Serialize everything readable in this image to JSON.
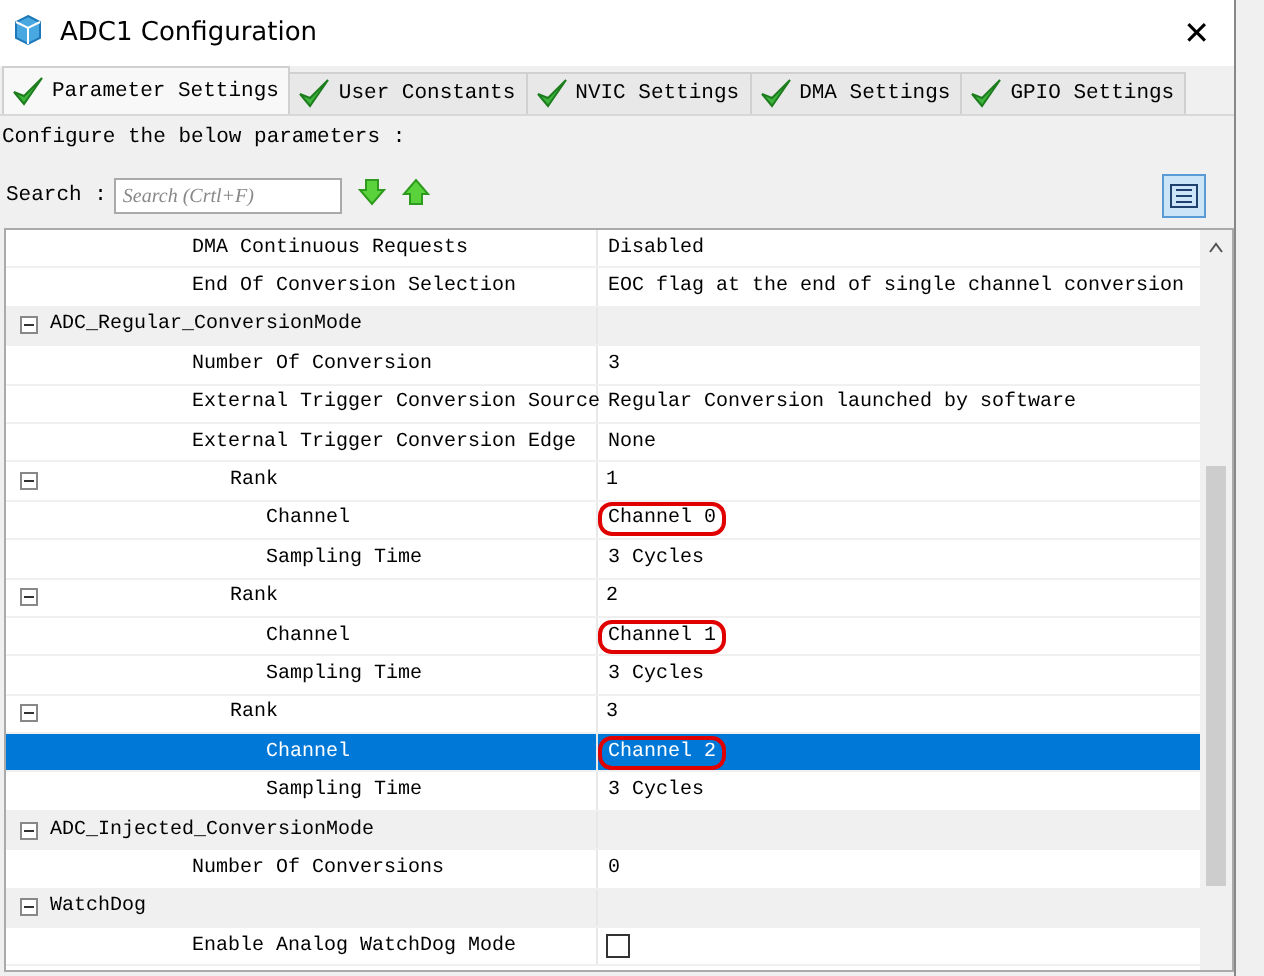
{
  "window": {
    "title": "ADC1 Configuration",
    "close": "✕"
  },
  "tabs": [
    {
      "label": "Parameter Settings",
      "selected": true
    },
    {
      "label": "User Constants",
      "selected": false
    },
    {
      "label": "NVIC Settings",
      "selected": false
    },
    {
      "label": "DMA Settings",
      "selected": false
    },
    {
      "label": "GPIO Settings",
      "selected": false
    }
  ],
  "instruction": "Configure the below parameters :",
  "search": {
    "label": "Search :",
    "placeholder": "Search (Crtl+F)"
  },
  "tree": [
    {
      "kind": "continuation",
      "children": [
        {
          "kind": "param",
          "label": "DMA Continuous Requests",
          "value": "Disabled",
          "selected": false,
          "circled": false
        },
        {
          "kind": "param",
          "label": "End Of Conversion Selection",
          "value": "EOC flag at the end of single channel conversion",
          "selected": false,
          "circled": false
        }
      ]
    },
    {
      "kind": "group",
      "label": "ADC_Regular_ConversionMode",
      "expanded": true,
      "selected": false,
      "children": [
        {
          "kind": "param",
          "label": "Number Of Conversion",
          "value": "3",
          "selected": false,
          "circled": false
        },
        {
          "kind": "param",
          "label": "External Trigger Conversion Source",
          "value": "Regular Conversion launched by software",
          "selected": false,
          "circled": false
        },
        {
          "kind": "param",
          "label": "External Trigger Conversion Edge",
          "value": "None",
          "selected": false,
          "circled": false
        },
        {
          "kind": "group",
          "label": "Rank",
          "value": "1",
          "expanded": true,
          "selected": false,
          "children": [
            {
              "kind": "param",
              "label": "Channel",
              "value": "Channel 0",
              "selected": false,
              "circled": true
            },
            {
              "kind": "param",
              "label": "Sampling Time",
              "value": "3 Cycles",
              "selected": false,
              "circled": false
            }
          ]
        },
        {
          "kind": "group",
          "label": "Rank",
          "value": "2",
          "expanded": true,
          "selected": false,
          "children": [
            {
              "kind": "param",
              "label": "Channel",
              "value": "Channel 1",
              "selected": false,
              "circled": true
            },
            {
              "kind": "param",
              "label": "Sampling Time",
              "value": "3 Cycles",
              "selected": false,
              "circled": false
            }
          ]
        },
        {
          "kind": "group",
          "label": "Rank",
          "value": "3",
          "expanded": true,
          "selected": false,
          "children": [
            {
              "kind": "param",
              "label": "Channel",
              "value": "Channel 2",
              "selected": true,
              "circled": true
            },
            {
              "kind": "param",
              "label": "Sampling Time",
              "value": "3 Cycles",
              "selected": false,
              "circled": false
            }
          ]
        }
      ]
    },
    {
      "kind": "group",
      "label": "ADC_Injected_ConversionMode",
      "expanded": true,
      "selected": false,
      "children": [
        {
          "kind": "param",
          "label": "Number Of Conversions",
          "value": "0",
          "selected": false,
          "circled": false
        }
      ]
    },
    {
      "kind": "group",
      "label": "WatchDog",
      "expanded": true,
      "selected": false,
      "children": [
        {
          "kind": "checkbox",
          "label": "Enable Analog WatchDog Mode",
          "checked": false,
          "selected": false
        }
      ]
    }
  ]
}
